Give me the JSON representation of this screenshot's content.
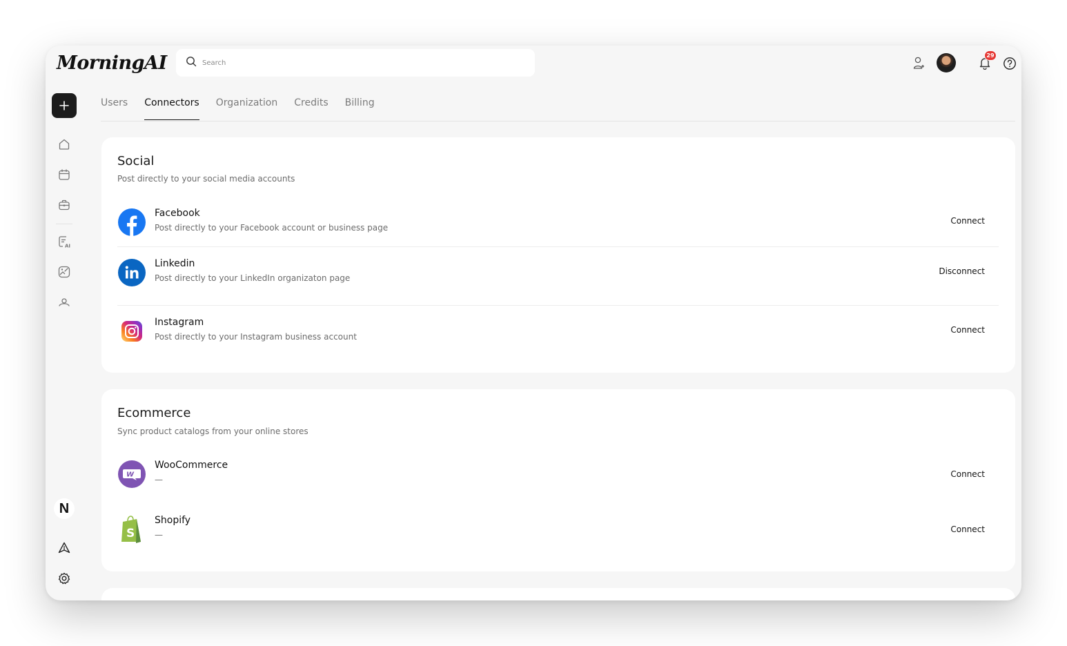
{
  "app": {
    "logo": "MorningAI"
  },
  "search": {
    "placeholder": "Search"
  },
  "header": {
    "notification_count": "29"
  },
  "sidebar": {
    "bottom_avatar_letter": "N"
  },
  "tabs": [
    "Users",
    "Connectors",
    "Organization",
    "Credits",
    "Billing"
  ],
  "active_tab": "Connectors",
  "sections": [
    {
      "title": "Social",
      "subtitle": "Post directly to your social media accounts",
      "items": [
        {
          "name": "Facebook",
          "description": "Post directly to your Facebook account or business page",
          "action": "Connect",
          "icon": "facebook-icon"
        },
        {
          "name": "Linkedin",
          "description": "Post directly to your LinkedIn organizaton page",
          "action": "Disconnect",
          "icon": "linkedin-icon"
        },
        {
          "name": "Instagram",
          "description": "Post directly to your Instagram business account",
          "action": "Connect",
          "icon": "instagram-icon"
        }
      ]
    },
    {
      "title": "Ecommerce",
      "subtitle": "Sync product catalogs from your online stores",
      "items": [
        {
          "name": "WooCommerce",
          "description": "—",
          "action": "Connect",
          "icon": "woocommerce-icon"
        },
        {
          "name": "Shopify",
          "description": "—",
          "action": "Connect",
          "icon": "shopify-icon"
        }
      ]
    }
  ],
  "colors": {
    "facebook": "#1877f2",
    "linkedin": "#0a66c2",
    "woocommerce": "#7f54b3",
    "shopify": "#95bf47",
    "badge": "#e53935"
  }
}
